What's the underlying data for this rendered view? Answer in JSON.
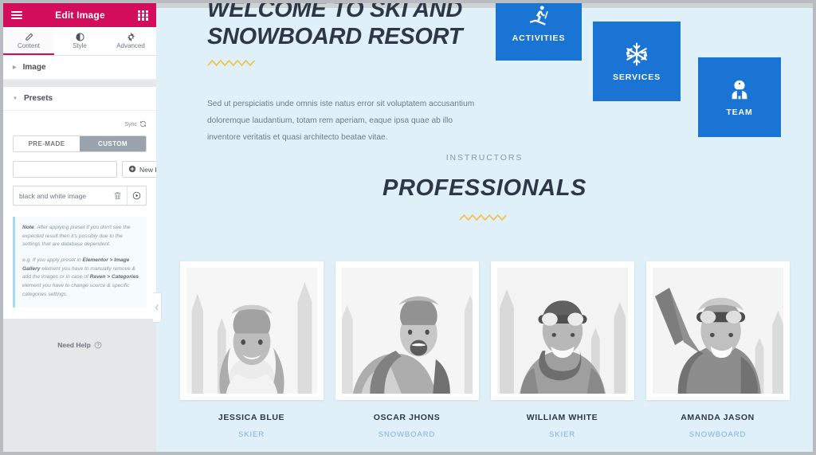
{
  "panel": {
    "title": "Edit Image",
    "menu_icon": "hamburger-icon",
    "apps_icon": "apps-grid-icon",
    "tabs": [
      {
        "label": "Content",
        "icon": "pencil-icon",
        "active": true
      },
      {
        "label": "Style",
        "icon": "contrast-icon",
        "active": false
      },
      {
        "label": "Advanced",
        "icon": "gear-icon",
        "active": false
      }
    ],
    "sections": [
      {
        "label": "Image",
        "expanded": false
      },
      {
        "label": "Presets",
        "expanded": true
      }
    ],
    "presets": {
      "sync_label": "Sync",
      "sync_icon": "sync-icon",
      "segments": [
        {
          "label": "PRE-MADE",
          "active": false
        },
        {
          "label": "CUSTOM",
          "active": true
        }
      ],
      "name_input_value": "",
      "name_input_placeholder": "",
      "new_preset_label": "New Preset",
      "new_preset_icon": "plus-circle-icon",
      "items": [
        {
          "name": "black and white image",
          "delete_icon": "trash-icon",
          "apply_icon": "play-circle-icon"
        }
      ],
      "note": {
        "paragraph1_lead": "Note",
        "paragraph1": ": After applying preset if you don't see the expected result then it's possibly due to the settings that are database dependent.",
        "paragraph2_a": "e.g. If you apply preset in ",
        "paragraph2_b1": "Elementor > Image Gallery",
        "paragraph2_c": " element you have to manually remove & add the images or in case of ",
        "paragraph2_b2": "Raven > Categories",
        "paragraph2_d": " element you have to change source & specific categories settings."
      }
    },
    "need_help": {
      "label": "Need Help",
      "icon": "question-circle-icon"
    },
    "collapse_handle_icon": "chevron-left-icon"
  },
  "preview": {
    "hero": {
      "title": "WELCOME TO SKI AND SNOWBOARD RESORT",
      "body": "Sed ut perspiciatis unde omnis iste natus error sit voluptatem accusantium doloremque laudantium, totam rem aperiam, eaque ipsa quae ab illo inventore veritatis et quasi architecto beatae vitae."
    },
    "cards": [
      {
        "label": "ACTIVITIES",
        "icon": "skier-icon"
      },
      {
        "label": "SERVICES",
        "icon": "snowflake-icon"
      },
      {
        "label": "TEAM",
        "icon": "team-person-icon"
      }
    ],
    "instructors": {
      "eyebrow": "INSTRUCTORS",
      "title": "PROFESSIONALS",
      "members": [
        {
          "name": "JESSICA BLUE",
          "role": "SKIER"
        },
        {
          "name": "OSCAR JHONS",
          "role": "SNOWBOARD"
        },
        {
          "name": "WILLIAM WHITE",
          "role": "SKIER"
        },
        {
          "name": "AMANDA JASON",
          "role": "SNOWBOARD"
        }
      ]
    }
  },
  "colors": {
    "panel_header": "#d30c5c",
    "card_blue": "#1a74d4",
    "canvas_bg": "#e0f0f8",
    "accent_zigzag": "#f2c14e",
    "role_text": "#7fb0e4"
  }
}
